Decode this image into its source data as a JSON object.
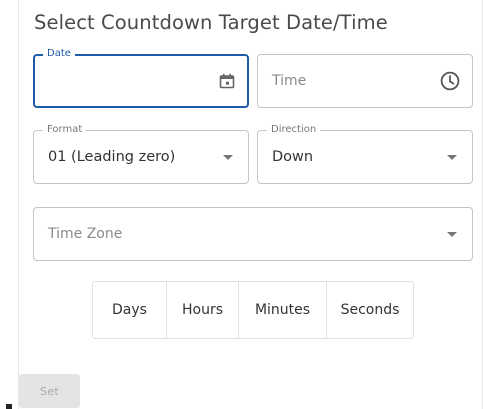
{
  "dialog": {
    "title": "Select Countdown Target Date/Time"
  },
  "date_field": {
    "label": "Date",
    "value": "",
    "icon": "calendar-icon",
    "focused": true
  },
  "time_field": {
    "placeholder": "Time",
    "icon": "clock-icon"
  },
  "format_select": {
    "label": "Format",
    "value": "01 (Leading zero)"
  },
  "direction_select": {
    "label": "Direction",
    "value": "Down"
  },
  "timezone_select": {
    "placeholder": "Time Zone"
  },
  "units": {
    "days": "Days",
    "hours": "Hours",
    "minutes": "Minutes",
    "seconds": "Seconds"
  },
  "actions": {
    "set_label": "Set"
  },
  "colors": {
    "accent": "#1f5aa8",
    "border": "#c4c4c4",
    "disabled_bg": "#e4e4e4",
    "disabled_text": "#a9a9a9"
  }
}
